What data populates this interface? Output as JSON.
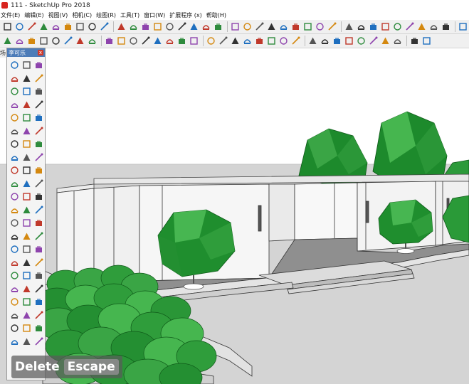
{
  "window": {
    "title": "111 - SketchUp Pro 2018"
  },
  "menu": [
    "文件(E)",
    "编辑(E)",
    "视图(V)",
    "相机(C)",
    "绘图(R)",
    "工具(T)",
    "窗口(W)",
    "扩展程序 (x)",
    "帮助(H)"
  ],
  "toolbar_row1": [
    "line-icon",
    "rect-icon",
    "pencil-icon",
    "arc-icon",
    "freehand-icon",
    "curve-icon",
    "pushpull-icon",
    "move-icon",
    "rotate-icon",
    "offset-icon",
    "scale-icon",
    "follow-icon",
    "tape-icon",
    "protractor-icon",
    "text-icon",
    "axes-icon",
    "dim-icon",
    "section-icon",
    "orbit-icon",
    "pan-icon",
    "zoom-icon",
    "zoomwin-icon",
    "extents-icon",
    "prev-icon",
    "next-icon",
    "walk-icon",
    "look-icon",
    "position-icon",
    "sandbox-icon",
    "smoove-icon",
    "stamp-icon",
    "drape-icon",
    "grid-icon",
    "tile-icon",
    "fill-icon",
    "warehouse-icon",
    "share-icon",
    "ext-icon",
    "layout-icon",
    "style-icon",
    "select-icon",
    "paint-icon",
    "eraser-icon",
    "tape2-icon",
    "crosshair-icon",
    "cam-icon",
    "walk2-icon"
  ],
  "toolbar_row2": [
    "eye-icon",
    "teapot-icon",
    "tag-icon",
    "cloud-icon",
    "iso-icon",
    "top-icon",
    "front-icon",
    "right-icon",
    "back-icon",
    "left-icon",
    "bottom-icon",
    "xray-icon",
    "backedge-icon",
    "wire-icon",
    "hidden-icon",
    "shaded-icon",
    "texture-icon",
    "mono-icon",
    "solid1-icon",
    "solid2-icon",
    "solid3-icon",
    "solid4-icon",
    "solid5-icon",
    "solid6-icon",
    "shadow-icon",
    "fog-icon",
    "cube1-icon",
    "cube2-icon",
    "cube3-icon",
    "cube4-icon",
    "cube5-icon",
    "house-icon",
    "cam2-icon",
    "sect2-icon"
  ],
  "tray": {
    "title": "李可乐",
    "close": "x",
    "icon_count": 66
  },
  "layer_tab": "场",
  "keys": {
    "action": "Delete",
    "pressed": "Escape"
  },
  "colors": {
    "sky": "#ffffff",
    "ground": "#d4d4d4",
    "wall": "#f2f2f2",
    "tree_dark": "#1d8a2c",
    "tree_light": "#46b64f",
    "tray_head": "#4d7cb8"
  }
}
